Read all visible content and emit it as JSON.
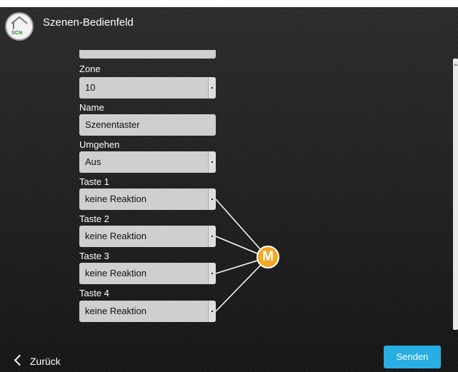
{
  "header": {
    "logo_text": "SCN",
    "title": "Szenen-Bedienfeld"
  },
  "form": {
    "zone": {
      "label": "Zone",
      "value": "10"
    },
    "name": {
      "label": "Name",
      "value": "Szenentaster"
    },
    "umgehen": {
      "label": "Umgehen",
      "value": "Aus"
    },
    "taste1": {
      "label": "Taste 1",
      "value": "keine Reaktion"
    },
    "taste2": {
      "label": "Taste 2",
      "value": "keine Reaktion"
    },
    "taste3": {
      "label": "Taste 3",
      "value": "keine Reaktion"
    },
    "taste4": {
      "label": "Taste 4",
      "value": "keine Reaktion"
    }
  },
  "badge": {
    "text": "M",
    "color": "#f5a623"
  },
  "footer": {
    "back_label": "Zurück",
    "send_label": "Senden",
    "send_color": "#29aee3"
  }
}
